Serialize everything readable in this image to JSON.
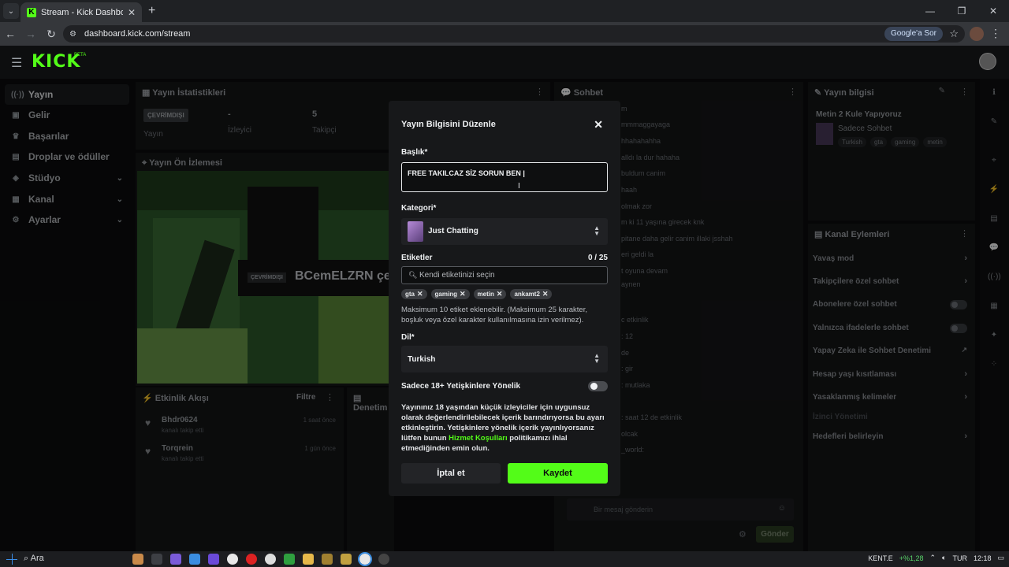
{
  "browser": {
    "tab_title": "Stream - Kick Dashboard",
    "url": "dashboard.kick.com/stream",
    "google_button": "Google'a Sor"
  },
  "app": {
    "logo": "KICK",
    "logo_badge": "BETA"
  },
  "sidebar": {
    "items": [
      {
        "label": "Yayın"
      },
      {
        "label": "Gelir"
      },
      {
        "label": "Başarılar"
      },
      {
        "label": "Droplar ve ödüller"
      },
      {
        "label": "Stüdyo"
      },
      {
        "label": "Kanal"
      },
      {
        "label": "Ayarlar"
      }
    ]
  },
  "stats_panel": {
    "title": "Yayın İstatistikleri",
    "offline_badge": "ÇEVRİMDIŞI",
    "col1_label": "Yayın",
    "viewers_value": "-",
    "viewers_label": "İzleyici",
    "followers_value": "5",
    "followers_label": "Takipçi"
  },
  "preview_panel": {
    "title": "Yayın Ön İzlemesi",
    "offline_badge": "ÇEVRİMDIŞI",
    "channel_name": "BCemELZRN çe"
  },
  "activity_panel": {
    "title": "Etkinlik Akışı",
    "filter": "Filtre",
    "side_title": "Denetim",
    "events": [
      {
        "user": "Bhdr0624",
        "action": "kanalı takip etti",
        "time": "1 saat önce"
      },
      {
        "user": "Torqrein",
        "action": "kanalı takip etti",
        "time": "1 gün önce"
      }
    ]
  },
  "chat_panel": {
    "title": "Sohbet",
    "lines": [
      "m",
      "mmmaggayaga",
      "hhahahahha",
      "alldı la dur hahaha",
      "buldum canim",
      "haah",
      "olmak zor",
      "m ki 11 yaşına girecek knk",
      "pitane daha gelir canim illaki jsshah",
      "eri geldi la",
      "t oyuna devam",
      "aynen",
      "c etkinlik",
      ": 12",
      "de",
      ": gir",
      ": mutlaka",
      ": saat 12 de etkinlik",
      "olcak",
      "_world:"
    ],
    "input_placeholder": "Bir mesaj gönderin",
    "send_button": "Gönder"
  },
  "stream_info_panel": {
    "title": "Yayın bilgisi",
    "stream_title": "Metin 2 Kule Yapıyoruz",
    "category": "Sadece Sohbet",
    "tags": [
      "Turkish",
      "gta",
      "gaming",
      "metin"
    ]
  },
  "channel_actions_panel": {
    "title": "Kanal Eylemleri",
    "rows": [
      {
        "label": "Yavaş mod",
        "control": "chevron"
      },
      {
        "label": "Takipçilere özel sohbet",
        "control": "chevron"
      },
      {
        "label": "Abonelere özel sohbet",
        "control": "toggle"
      },
      {
        "label": "Yalnızca ifadelerle sohbet",
        "control": "toggle"
      },
      {
        "label": "Yapay Zeka ile Sohbet Denetimi",
        "control": "external"
      },
      {
        "label": "Hesap yaşı kısıtlaması",
        "control": "chevron"
      },
      {
        "label": "Yasaklanmış kelimeler",
        "control": "chevron"
      },
      {
        "label": "İzinci Yönetimi",
        "control": "none"
      },
      {
        "label": "Hedefleri belirleyin",
        "control": "chevron"
      }
    ]
  },
  "modal": {
    "title": "Yayın Bilgisini Düzenle",
    "title_label": "Başlık*",
    "title_value": "FREE TAKILCAZ SİZ SORUN BEN ",
    "category_label": "Kategori*",
    "category_value": "Just Chatting",
    "tags_label": "Etiketler",
    "tags_count": "0 / 25",
    "tags_placeholder": "Kendi etiketinizi seçin",
    "tags": [
      "gta",
      "gaming",
      "metin",
      "ankamt2"
    ],
    "tags_help": "Maksimum 10 etiket eklenebilir. (Maksimum 25 karakter, boşluk veya özel karakter kullanılmasına izin verilmez).",
    "language_label": "Dil*",
    "language_value": "Turkish",
    "adult_label": "Sadece 18+ Yetişkinlere Yönelik",
    "adult_on": false,
    "adult_desc_before": "Yayınınız 18 yaşından küçük izleyiciler için uygunsuz olarak değerlendirilebilecek içerik barındırıyorsa bu ayarı etkinleştirin. Yetişkinlere yönelik içerik yayınlıyorsanız lütfen bunun ",
    "adult_desc_link": "Hizmet Koşulları",
    "adult_desc_after": " politikamızı ihlal etmediğinden emin olun.",
    "cancel_button": "İptal et",
    "save_button": "Kaydet"
  },
  "taskbar": {
    "search": "Ara",
    "ticker": "KENT.E",
    "ticker_change": "+%1,28",
    "lang": "TUR",
    "time": "12:18"
  },
  "colors": {
    "accent": "#53fc18",
    "modal_bg": "#17181a",
    "page_bg": "#0b0c0d"
  }
}
